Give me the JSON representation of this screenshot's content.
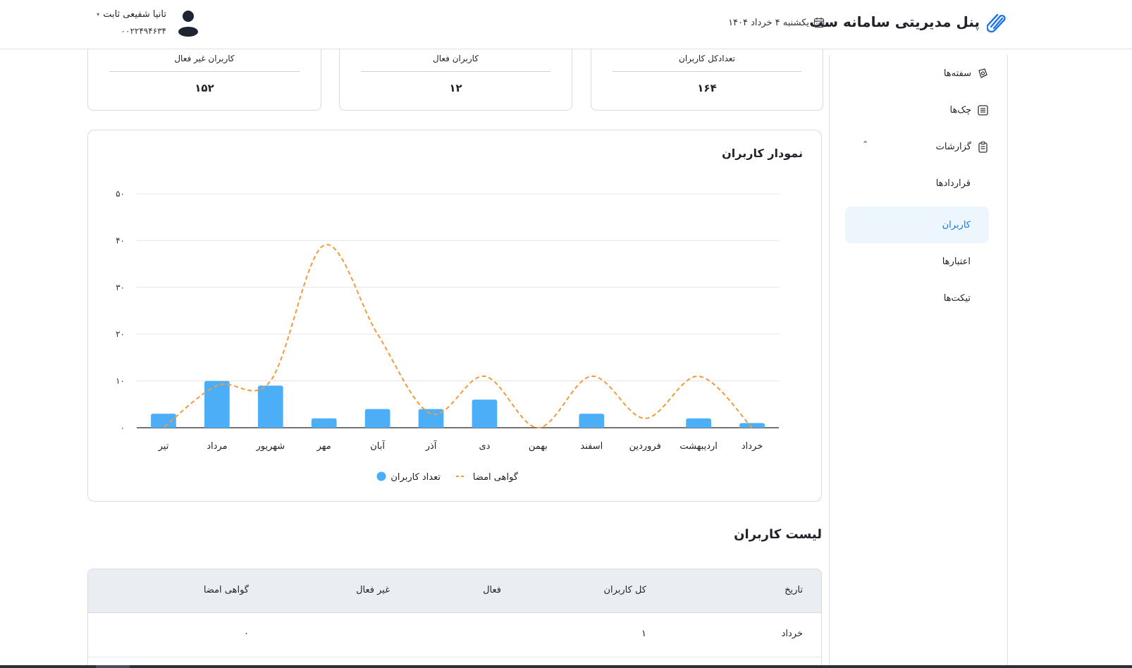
{
  "header": {
    "app_title": "پنل مدیریتی سامانه ست",
    "date": "یکشنبه ۴ خرداد ۱۴۰۴",
    "user_name": "تانیا شفیعی ثابت",
    "user_id": "۰۰۲۲۴۹۴۶۳۴"
  },
  "sidebar": {
    "items": [
      {
        "label": "سفته‌ها",
        "icon": "promissory-note-icon"
      },
      {
        "label": "چک‌ها",
        "icon": "check-list-icon"
      },
      {
        "label": "گزارشات",
        "icon": "clipboard-report-icon"
      },
      {
        "label": "قراردادها"
      },
      {
        "label": "کاربران"
      },
      {
        "label": "اعتبارها"
      },
      {
        "label": "تیکت‌ها"
      }
    ]
  },
  "stats": {
    "total_label": "تعدادکل کاربران",
    "total_value": "۱۶۴",
    "active_label": "کاربران فعال",
    "active_value": "۱۲",
    "inactive_label": "کاربران غیر فعال",
    "inactive_value": "۱۵۲"
  },
  "chart": {
    "title": "نمودار کاربران"
  },
  "chart_data": {
    "type": "bar",
    "categories": [
      "خرداد",
      "اردیبهشت",
      "فروردین",
      "اسفند",
      "بهمن",
      "دی",
      "آذر",
      "آبان",
      "مهر",
      "شهریور",
      "مرداد",
      "تیر"
    ],
    "series": [
      {
        "name": "تعداد کاربران",
        "type": "bar",
        "color": "#4daef8",
        "values": [
          1,
          2,
          0,
          3,
          0,
          6,
          4,
          4,
          2,
          9,
          10,
          3
        ]
      },
      {
        "name": "گواهی امضا",
        "type": "line",
        "style": "dashed",
        "color": "#f59a3b",
        "values": [
          0,
          11,
          2,
          11,
          0,
          11,
          3,
          20,
          39,
          10,
          9,
          0
        ]
      }
    ],
    "y_ticks": [
      "۰",
      "۱۰",
      "۲۰",
      "۳۰",
      "۴۰",
      "۵۰"
    ],
    "ylim": [
      0,
      50
    ],
    "grid": true,
    "legend_position": "bottom-center"
  },
  "list": {
    "title": "لیست کاربران",
    "columns": [
      "تاریخ",
      "کل کاربران",
      "فعال",
      "غیر فعال",
      "گواهی امضا"
    ],
    "rows": [
      [
        "خرداد",
        "۱",
        "",
        "",
        "۰"
      ]
    ]
  },
  "colors": {
    "accent": "#1a73e8",
    "bar": "#4daef8",
    "line": "#f59a3b",
    "active_bg": "#eef6fd"
  }
}
